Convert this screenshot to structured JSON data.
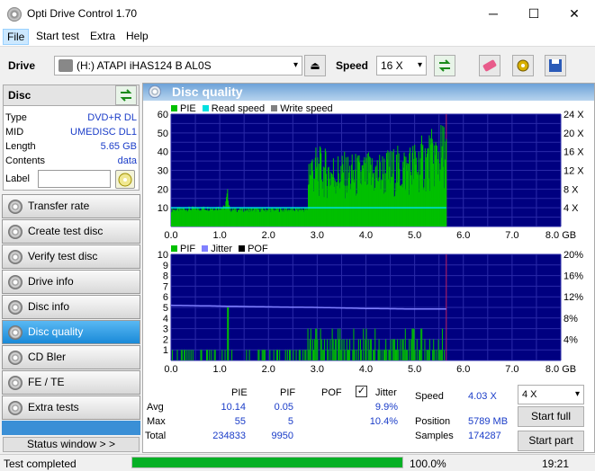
{
  "window": {
    "title": "Opti Drive Control 1.70",
    "minimize": "─",
    "maximize": "☐",
    "close": "✕"
  },
  "menu": {
    "file": "File",
    "start_test": "Start test",
    "extra": "Extra",
    "help": "Help"
  },
  "toolbar": {
    "drive_label": "Drive",
    "drive_value": "(H:)   ATAPI iHAS124   B AL0S",
    "speed_label": "Speed",
    "speed_value": "16 X"
  },
  "disc": {
    "heading": "Disc",
    "rows": [
      {
        "key": "Type",
        "value": "DVD+R DL"
      },
      {
        "key": "MID",
        "value": "UMEDISC DL1"
      },
      {
        "key": "Length",
        "value": "5.65 GB"
      },
      {
        "key": "Contents",
        "value": "data"
      }
    ],
    "label_key": "Label",
    "label_value": ""
  },
  "nav": [
    "Transfer rate",
    "Create test disc",
    "Verify test disc",
    "Drive info",
    "Disc info",
    "Disc quality",
    "CD Bler",
    "FE / TE",
    "Extra tests"
  ],
  "nav_active": 5,
  "status_window": "Status window > >",
  "panel": {
    "title": "Disc quality"
  },
  "chart_data": [
    {
      "type": "area",
      "legend": [
        "PIE",
        "Read speed",
        "Write speed"
      ],
      "colors": {
        "PIE": "#00c000",
        "Read speed": "#00e0e0",
        "Write speed": "#808080"
      },
      "x_ticks": [
        "0.0",
        "1.0",
        "2.0",
        "3.0",
        "4.0",
        "5.0",
        "6.0",
        "7.0",
        "8.0 GB"
      ],
      "y_left_ticks": [
        "60",
        "50",
        "40",
        "30",
        "20",
        "10"
      ],
      "y_right_ticks": [
        "24 X",
        "20 X",
        "16 X",
        "12 X",
        "8 X",
        "4 X"
      ],
      "xlim": [
        0,
        8
      ],
      "ylim": [
        0,
        60
      ],
      "y2lim": [
        0,
        24
      ],
      "disc_end_gb": 5.65,
      "pie_profile": [
        [
          0.0,
          9
        ],
        [
          1.1,
          10
        ],
        [
          1.15,
          18
        ],
        [
          1.2,
          9
        ],
        [
          2.8,
          9
        ],
        [
          2.82,
          45
        ],
        [
          3.2,
          42
        ],
        [
          3.6,
          40
        ],
        [
          4.0,
          40
        ],
        [
          4.4,
          42
        ],
        [
          4.8,
          45
        ],
        [
          5.2,
          50
        ],
        [
          5.65,
          58
        ]
      ],
      "read_speed_x": 4.0
    },
    {
      "type": "bar",
      "legend": [
        "PIF",
        "Jitter",
        "POF"
      ],
      "colors": {
        "PIF": "#00c000",
        "Jitter": "#8080ff",
        "POF": "#000000"
      },
      "x_ticks": [
        "0.0",
        "1.0",
        "2.0",
        "3.0",
        "4.0",
        "5.0",
        "6.0",
        "7.0",
        "8.0 GB"
      ],
      "y_left_ticks": [
        "10",
        "9",
        "8",
        "7",
        "6",
        "5",
        "4",
        "3",
        "2",
        "1"
      ],
      "y_right_ticks": [
        "20%",
        "16%",
        "12%",
        "8%",
        "4%"
      ],
      "xlim": [
        0,
        8
      ],
      "ylim": [
        0,
        10
      ],
      "y2lim": [
        0,
        20
      ],
      "disc_end_gb": 5.65,
      "jitter_profile": [
        [
          0.0,
          10.4
        ],
        [
          2.0,
          10.1
        ],
        [
          3.0,
          10.0
        ],
        [
          4.0,
          9.8
        ],
        [
          5.0,
          9.7
        ],
        [
          5.65,
          9.7
        ]
      ],
      "pif_spike_gb": 1.15,
      "pif_spike_value": 5
    }
  ],
  "stats": {
    "col_pie": "PIE",
    "col_pif": "PIF",
    "col_pof": "POF",
    "col_jitter": "Jitter",
    "avg_label": "Avg",
    "max_label": "Max",
    "total_label": "Total",
    "pie_avg": "10.14",
    "pie_max": "55",
    "pie_total": "234833",
    "pif_avg": "0.05",
    "pif_max": "5",
    "pif_total": "9950",
    "jit_avg": "9.9%",
    "jit_max": "10.4%",
    "speed_label": "Speed",
    "speed_value": "4.03 X",
    "position_label": "Position",
    "position_value": "5789 MB",
    "samples_label": "Samples",
    "samples_value": "174287",
    "speed_select": "4 X",
    "start_full": "Start full",
    "start_part": "Start part"
  },
  "status": {
    "text": "Test completed",
    "progress_pct": 100,
    "progress_label": "100.0%",
    "time": "19:21"
  }
}
